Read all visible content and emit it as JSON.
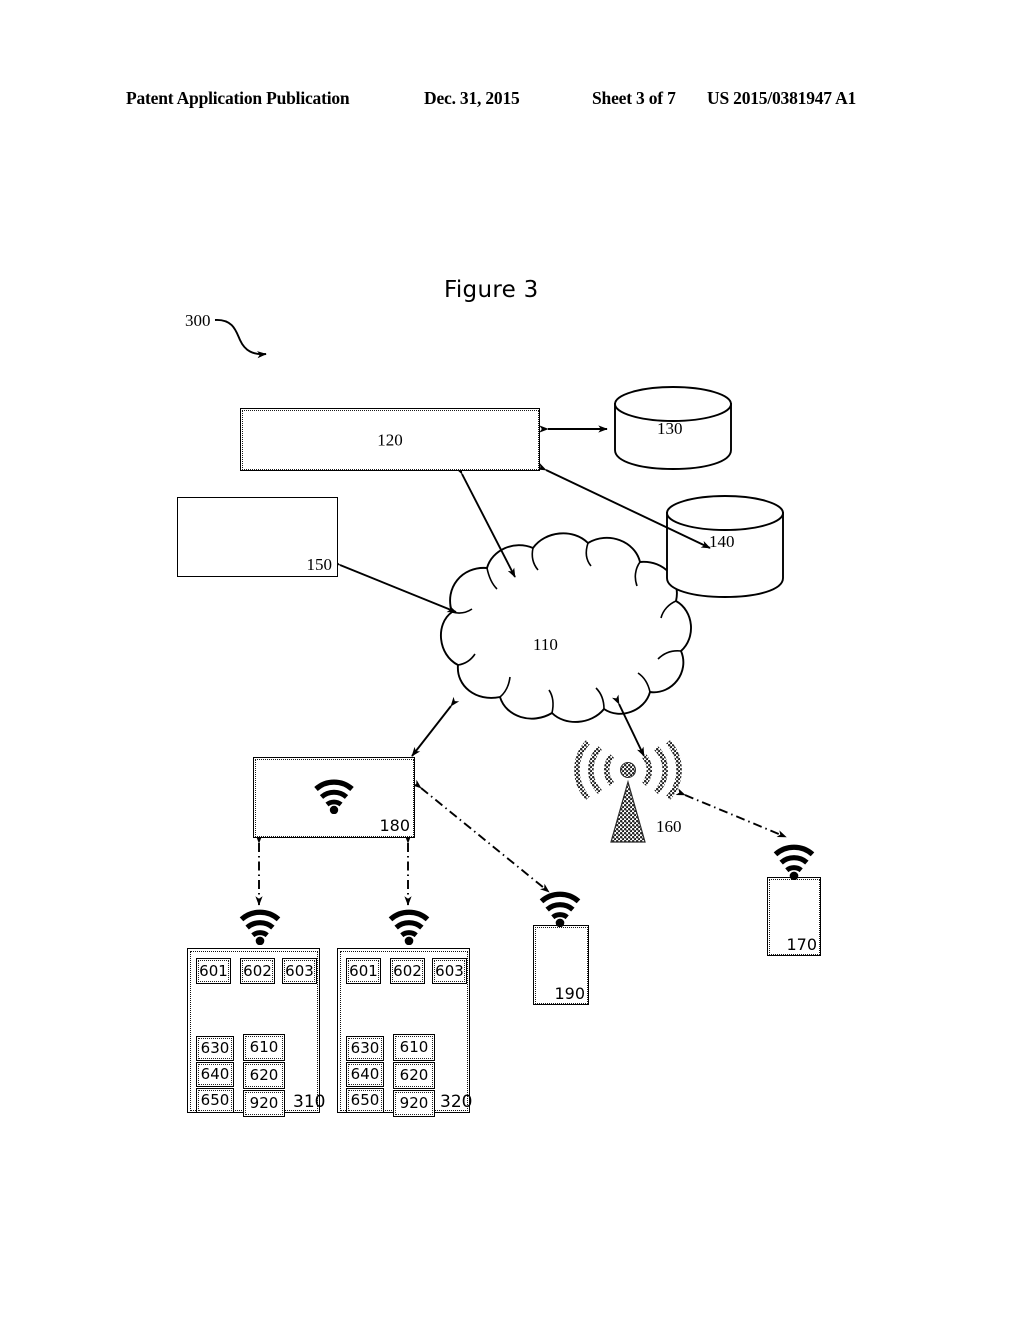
{
  "header": {
    "publication": "Patent Application Publication",
    "date": "Dec. 31, 2015",
    "sheet": "Sheet 3 of 7",
    "number": "US 2015/0381947 A1"
  },
  "figure": {
    "title": "Figure 3",
    "diagram_ref": "300"
  },
  "nodes": {
    "server_120": "120",
    "db_130": "130",
    "db_140": "140",
    "box_150": "150",
    "cloud_110": "110",
    "tower_160": "160",
    "device_170": "170",
    "router_180": "180",
    "device_190": "190",
    "device_310": "310",
    "device_320": "320"
  },
  "device_310_modules": {
    "top_row": [
      "601",
      "602",
      "603"
    ],
    "left_col": [
      "630",
      "640",
      "650"
    ],
    "right_col": [
      "610",
      "620",
      "920"
    ]
  },
  "device_320_modules": {
    "top_row": [
      "601",
      "602",
      "603"
    ],
    "left_col": [
      "630",
      "640",
      "650"
    ],
    "right_col": [
      "610",
      "620",
      "920"
    ]
  },
  "icons": {
    "wifi": "wifi-icon",
    "tower": "cell-tower-icon",
    "cloud": "network-cloud-icon",
    "database": "database-cylinder-icon"
  },
  "colors": {
    "ink": "#000000",
    "paper": "#ffffff",
    "tower_fill": "#4a4a4a"
  }
}
